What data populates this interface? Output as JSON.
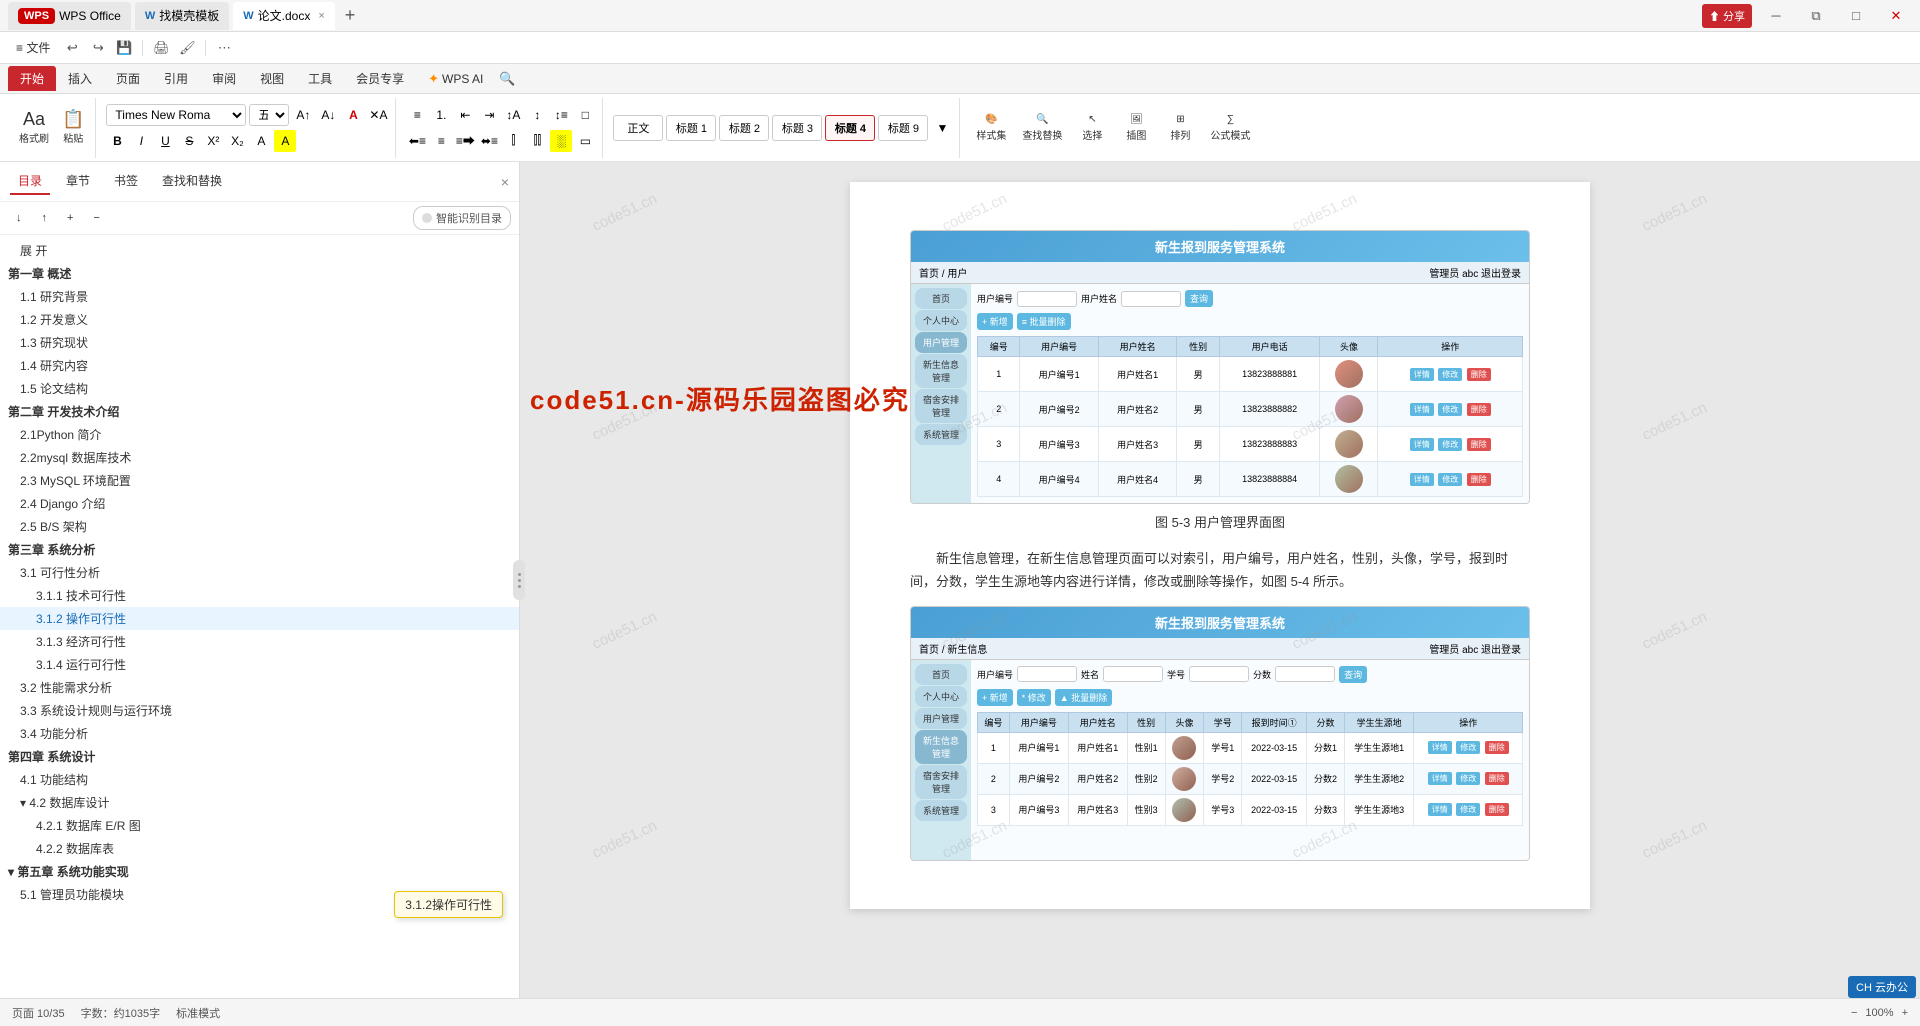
{
  "app": {
    "title": "WPS Office",
    "tabs": [
      {
        "id": "wps",
        "label": "WPS Office",
        "type": "wps"
      },
      {
        "id": "template",
        "label": "找模壳模板",
        "icon": "W",
        "active": false
      },
      {
        "id": "doc",
        "label": "论文.docx",
        "icon": "W",
        "active": true
      }
    ],
    "add_tab": "+",
    "win_buttons": [
      "─",
      "□",
      "✕"
    ]
  },
  "menu": {
    "items": [
      "≡ 文件",
      "撤销",
      "恢复",
      "保存",
      "另存为",
      "打印",
      "分享"
    ]
  },
  "ribbon": {
    "tabs": [
      "开始",
      "插入",
      "页面",
      "引用",
      "审阅",
      "视图",
      "工具",
      "会员专享",
      "WPS AI"
    ],
    "active_tab": "开始",
    "font_name": "Times New Roma",
    "font_size": "五号",
    "formatting_buttons": [
      "B",
      "I",
      "U",
      "S",
      "X²",
      "X₂",
      "A",
      "A"
    ],
    "para_styles": [
      "正文",
      "标题 1",
      "标题 2",
      "标题 3",
      "标题 4",
      "标题 9"
    ],
    "active_para_style": "标题 4",
    "right_tools": [
      "样式集",
      "查找替换",
      "选择",
      "插图",
      "排列",
      "公式模式"
    ]
  },
  "sidebar": {
    "tabs": [
      "目录",
      "章节",
      "书签",
      "查找和替换"
    ],
    "active_tab": "目录",
    "close_label": "×",
    "tools": [
      "↓",
      "↑",
      "+",
      "−"
    ],
    "ai_btn": "智能识别目录",
    "toc_items": [
      {
        "level": 2,
        "label": "展 开",
        "id": "expand"
      },
      {
        "level": 1,
        "label": "第一章 概述",
        "id": "ch1",
        "collapsed": false
      },
      {
        "level": 2,
        "label": "1.1 研究背景",
        "id": "1-1"
      },
      {
        "level": 2,
        "label": "1.2 开发意义",
        "id": "1-2"
      },
      {
        "level": 2,
        "label": "1.3 研究现状",
        "id": "1-3"
      },
      {
        "level": 2,
        "label": "1.4 研究内容",
        "id": "1-4"
      },
      {
        "level": 2,
        "label": "1.5 论文结构",
        "id": "1-5"
      },
      {
        "level": 1,
        "label": "第二章 开发技术介绍",
        "id": "ch2",
        "collapsed": false
      },
      {
        "level": 2,
        "label": "2.1Python 简介",
        "id": "2-1"
      },
      {
        "level": 2,
        "label": "2.2mysql 数据库技术",
        "id": "2-2"
      },
      {
        "level": 2,
        "label": "2.3 MySQL 环境配置",
        "id": "2-3"
      },
      {
        "level": 2,
        "label": "2.4 Django 介绍",
        "id": "2-4"
      },
      {
        "level": 2,
        "label": "2.5 B/S 架构",
        "id": "2-5"
      },
      {
        "level": 1,
        "label": "第三章 系统分析",
        "id": "ch3",
        "collapsed": false
      },
      {
        "level": 2,
        "label": "3.1 可行性分析",
        "id": "3-1",
        "collapsed": false
      },
      {
        "level": 3,
        "label": "3.1.1 技术可行性",
        "id": "3-1-1"
      },
      {
        "level": 3,
        "label": "3.1.2 操作可行性",
        "id": "3-1-2",
        "active": true
      },
      {
        "level": 3,
        "label": "3.1.3 经济可行性",
        "id": "3-1-3"
      },
      {
        "level": 3,
        "label": "3.1.4 运行可行性",
        "id": "3-1-4"
      },
      {
        "level": 2,
        "label": "3.2 性能需求分析",
        "id": "3-2"
      },
      {
        "level": 2,
        "label": "3.3 系统设计规则与运行环境",
        "id": "3-3"
      },
      {
        "level": 2,
        "label": "3.4 功能分析",
        "id": "3-4"
      },
      {
        "level": 1,
        "label": "第四章 系统设计",
        "id": "ch4",
        "collapsed": false
      },
      {
        "level": 2,
        "label": "4.1 功能结构",
        "id": "4-1"
      },
      {
        "level": 2,
        "label": "▾ 4.2 数据库设计",
        "id": "4-2",
        "collapsed": false
      },
      {
        "level": 3,
        "label": "4.2.1 数据库 E/R 图",
        "id": "4-2-1"
      },
      {
        "level": 3,
        "label": "4.2.2 数据库表",
        "id": "4-2-2"
      },
      {
        "level": 1,
        "label": "▾ 第五章 系统功能实现",
        "id": "ch5",
        "collapsed": false
      },
      {
        "level": 2,
        "label": "5.1 管理员功能模块",
        "id": "5-1"
      }
    ]
  },
  "tooltip": {
    "label": "3.1.2操作可行性"
  },
  "document": {
    "figure_caption_1": "图 5-3 用户管理界面图",
    "para_text": "新生信息管理，在新生信息管理页面可以对索引，用户编号，用户姓名，性别，头像，学号，报到时间，分数，学生生源地等内容进行详情，修改或删除等操作，如图 5-4 所示。",
    "sys1": {
      "title": "新生报到服务管理系统",
      "topbar_left": "首页 / 用户",
      "topbar_right": "管理员 abc    退出登录",
      "sidebar_items": [
        "首页",
        "个人中心",
        "用户管理",
        "新生信息管理",
        "宿舍安排管理",
        "系统管理"
      ],
      "active_sidebar": "用户管理",
      "search_labels": [
        "用户编号",
        "用户姓名"
      ],
      "search_btn": "查询",
      "action_btns": [
        "+ 新增",
        "≡ 批量删除"
      ],
      "table_headers": [
        "编号",
        "用户编号",
        "用户姓名",
        "性别",
        "用户电话",
        "头像",
        "操作"
      ],
      "rows": [
        {
          "no": "1",
          "id": "用户编号1",
          "name": "用户姓名1",
          "gender": "男",
          "phone": "13823888881",
          "ops": [
            "详情",
            "修改",
            "删除"
          ]
        },
        {
          "no": "2",
          "id": "用户编号2",
          "name": "用户姓名2",
          "gender": "男",
          "phone": "13823888882",
          "ops": [
            "详情",
            "修改",
            "删除"
          ]
        },
        {
          "no": "3",
          "id": "用户编号3",
          "name": "用户姓名3",
          "gender": "男",
          "phone": "13823888883",
          "ops": [
            "详情",
            "修改",
            "删除"
          ]
        },
        {
          "no": "4",
          "id": "用户编号4",
          "name": "用户姓名4",
          "gender": "男",
          "phone": "13823888884",
          "ops": [
            "详情",
            "修改",
            "删除"
          ]
        }
      ]
    },
    "sys2": {
      "title": "新生报到服务管理系统",
      "topbar_left": "首页 / 新生信息",
      "topbar_right": "管理员 abc    退出登录",
      "sidebar_items": [
        "首页",
        "个人中心",
        "用户管理",
        "新生信息管理",
        "宿舍安排管理",
        "系统管理"
      ],
      "active_sidebar": "新生信息管理",
      "search_labels": [
        "用户编号",
        "姓名",
        "学号",
        "分数"
      ],
      "search_btn": "查询",
      "action_btns": [
        "+ 新增",
        "* 修改",
        "▲ 批量删除"
      ],
      "table_headers": [
        "编号",
        "用户编号",
        "用户姓名",
        "性别",
        "头像",
        "学号",
        "报到时间①",
        "分数",
        "学生生源地",
        "操作"
      ],
      "rows": [
        {
          "no": "1",
          "uid": "用户编号1",
          "name": "用户姓名1",
          "gender": "性别1",
          "xuehao": "学号1",
          "time": "2022-03-15",
          "score": "分数1",
          "origin": "学生生源地1",
          "ops": [
            "详情",
            "修改",
            "删除"
          ]
        },
        {
          "no": "2",
          "uid": "用户编号2",
          "name": "用户姓名2",
          "gender": "性别2",
          "xuehao": "学号2",
          "time": "2022-03-15",
          "score": "分数2",
          "origin": "学生生源地2",
          "ops": [
            "详情",
            "修改",
            "删除"
          ]
        },
        {
          "no": "3",
          "uid": "用户编号3",
          "name": "用户姓名3",
          "gender": "性别3",
          "xuehao": "学号3",
          "time": "2022-03-15",
          "score": "分数3",
          "origin": "学生生源地3",
          "ops": [
            "详情",
            "修改",
            "删除"
          ]
        }
      ]
    }
  },
  "watermark": {
    "text": "code51.cn",
    "big_text": "code51.cn-源码乐园盗图必究"
  },
  "status": {
    "page_info": "页面 10/35",
    "word_count": "字数：约1035字",
    "layout_mode": "标准模式",
    "zoom": "100%"
  },
  "ch_badge": "CH 云办公"
}
